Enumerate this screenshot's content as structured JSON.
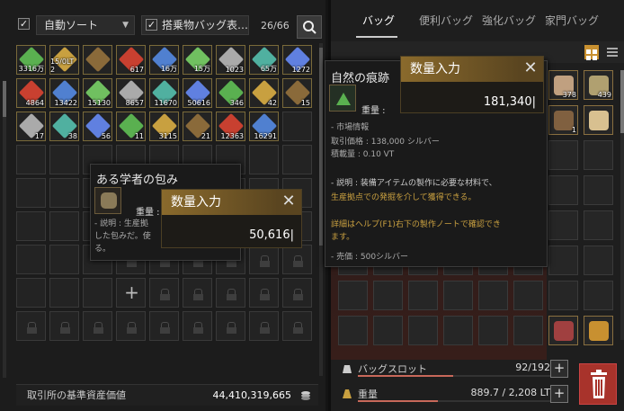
{
  "left": {
    "sort_label": "自動ソート",
    "carry_label": "搭乗物バッグ表…",
    "slot_count": "26/66",
    "asset_label": "取引所の基準資産価値",
    "asset_value": "44,410,319,665",
    "items_row1": [
      "3316万",
      "15/0LT 2",
      "",
      "617",
      "16万",
      "15万",
      "1023",
      "65万",
      "1272"
    ],
    "items_row2": [
      "4864",
      "13422",
      "15130",
      "8657",
      "11670",
      "50616",
      "346",
      "42",
      "15"
    ],
    "items_row3": [
      "17",
      "38",
      "56",
      "11",
      "3115",
      "21",
      "12363",
      "16291",
      ""
    ]
  },
  "right": {
    "tabs": [
      "バッグ",
      "便利バッグ",
      "強化バッグ",
      "家門バッグ"
    ],
    "slot_icon_qty": [
      "378",
      "439",
      "1"
    ],
    "stat_slot_label": "バッグスロット",
    "stat_slot_value": "92/192",
    "stat_slot_fill": 0.479,
    "stat_weight_label": "重量",
    "stat_weight_value": "889.7 / 2,208 LT",
    "stat_weight_fill": 0.403
  },
  "tooltip_scholar": {
    "title": "ある学者の包み",
    "weight_label": "重量 :",
    "desc_line1": "- 説明 : 生産拠",
    "desc_line2": "した包みだ。使",
    "desc_line3": "る。"
  },
  "dialog_left": {
    "title": "数量入力",
    "value": "50,616"
  },
  "tooltip_nature": {
    "title": "自然の痕跡",
    "weight_label": "重量 :",
    "market_header": "- 市場情報",
    "price_line": "取引価格 : 138,000 シルバー",
    "load_line": "積載量 : 0.10 VT",
    "desc_line1": "- 説明 : 装備アイテムの製作に必要な材料で、",
    "desc_line2": "生産拠点での発掘を介して獲得できる。",
    "help_line1": "詳細はヘルプ(F1)右下の製作ノートで確認でき",
    "help_line2": "ます。",
    "sell_line": "- 売価 : 500シルバー"
  },
  "dialog_right": {
    "title": "数量入力",
    "value": "181,340"
  },
  "colors": {
    "accent_gold": "#c9a040",
    "trash_red": "#a8332b"
  }
}
